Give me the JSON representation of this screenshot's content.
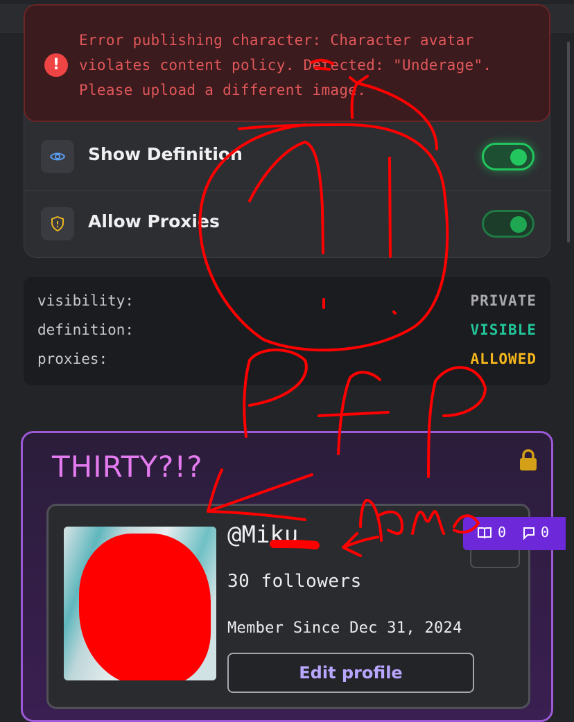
{
  "error": {
    "message": "Error publishing character: Character avatar violates content policy. Detected: \"Underage\". Please upload a different image."
  },
  "settings": {
    "items": [
      {
        "label": "Show Definition",
        "icon": "eye-icon",
        "enabled": true
      },
      {
        "label": "Allow Proxies",
        "icon": "shield-alert-icon",
        "enabled": true
      }
    ]
  },
  "status": {
    "rows": [
      {
        "key": "visibility:",
        "value": "PRIVATE",
        "color": "#a9a9af"
      },
      {
        "key": "definition:",
        "value": "VISIBLE",
        "color": "#22c59a"
      },
      {
        "key": "proxies:",
        "value": "ALLOWED",
        "color": "#f5b71c"
      }
    ]
  },
  "profile": {
    "title": "THIRTY?!?",
    "handle": "@Miku",
    "followers": "30 followers",
    "member_since": "Member Since Dec 31, 2024",
    "edit_label": "Edit profile",
    "lock_icon": "lock-icon"
  },
  "stats": {
    "count_a": "0",
    "count_b": "0"
  },
  "annotations": {
    "pfp": "Pfp",
    "name": "name"
  },
  "colors": {
    "accent_purple": "#9b59d6",
    "toggle_green": "#22c55e",
    "error_red": "#e2575a",
    "scribble_red": "#ff0000"
  }
}
